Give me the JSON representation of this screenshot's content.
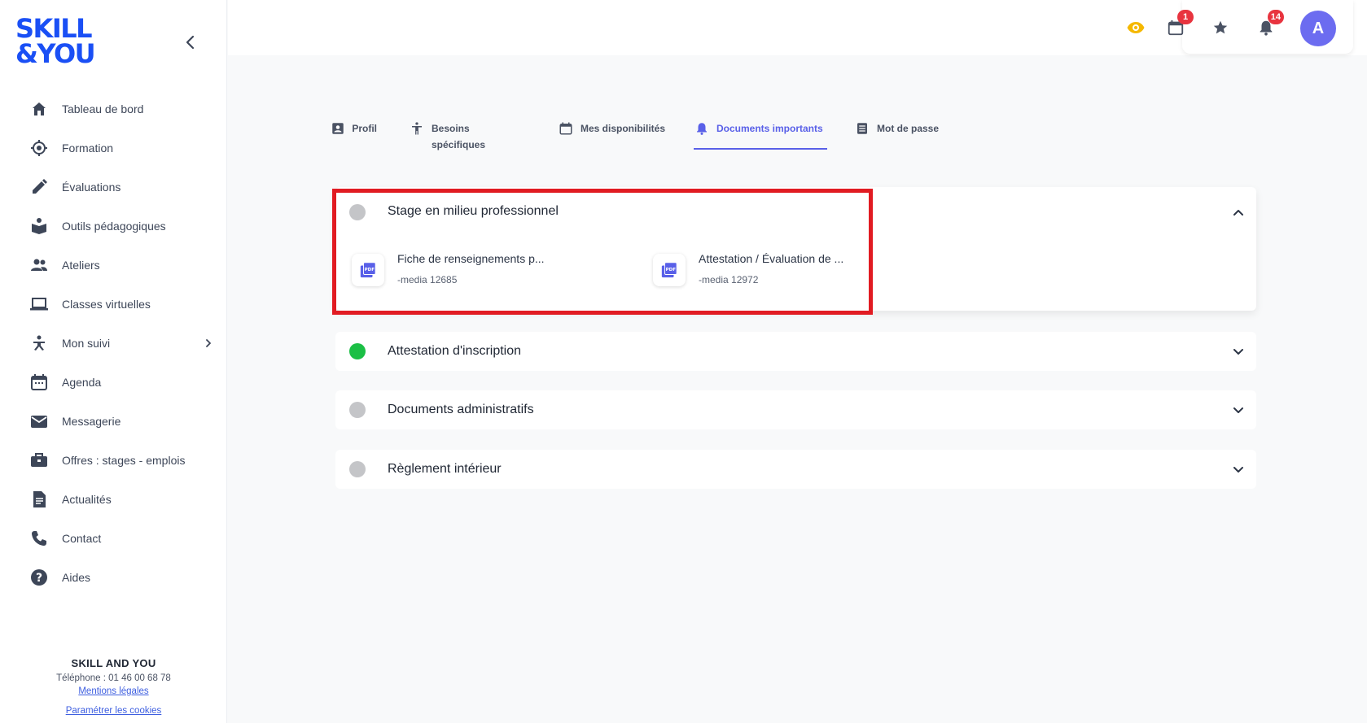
{
  "brand": {
    "line1": "SKILL",
    "line2": "&YOU",
    "color": "#1a4ff5"
  },
  "sidebar": {
    "items": [
      {
        "label": "Tableau de bord",
        "icon": "home-icon"
      },
      {
        "label": "Formation",
        "icon": "target-icon"
      },
      {
        "label": "Évaluations",
        "icon": "pencil-icon"
      },
      {
        "label": "Outils pédagogiques",
        "icon": "book-icon"
      },
      {
        "label": "Ateliers",
        "icon": "group-icon"
      },
      {
        "label": "Classes virtuelles",
        "icon": "laptop-icon"
      },
      {
        "label": "Mon suivi",
        "icon": "person-icon"
      },
      {
        "label": "Agenda",
        "icon": "calendar-icon"
      },
      {
        "label": "Messagerie",
        "icon": "mail-icon"
      },
      {
        "label": "Offres : stages - emplois",
        "icon": "briefcase-icon"
      },
      {
        "label": "Actualités",
        "icon": "news-icon"
      },
      {
        "label": "Contact",
        "icon": "phone-icon"
      },
      {
        "label": "Aides",
        "icon": "help-icon"
      }
    ],
    "footer": {
      "company": "SKILL AND YOU",
      "phone": "Téléphone : 01 46 00 68 78",
      "legal_link": "Mentions légales",
      "cookies_link": "Paramétrer les cookies"
    }
  },
  "header": {
    "calendar_badge": "1",
    "notifications_badge": "14",
    "avatar_initial": "A",
    "accent_eye": "#f5b800",
    "avatar_color": "#6c6cf0"
  },
  "tabs": [
    {
      "label": "Profil",
      "icon": "profile-card-icon",
      "active": false
    },
    {
      "label": "Besoins spécifiques",
      "icon": "accessibility-icon",
      "active": false
    },
    {
      "label": "Mes disponibilités",
      "icon": "calendar-icon",
      "active": false
    },
    {
      "label": "Documents importants",
      "icon": "bell-icon",
      "active": true
    },
    {
      "label": "Mot de passe",
      "icon": "document-icon",
      "active": false
    }
  ],
  "sections": [
    {
      "title": "Stage en milieu professionnel",
      "status_color": "#c4c5c8",
      "expanded": true,
      "documents": [
        {
          "name": "Fiche de renseignements p...",
          "meta": "-media 12685",
          "icon": "pdf-icon"
        },
        {
          "name": "Attestation / Évaluation de ...",
          "meta": "-media 12972",
          "icon": "pdf-icon"
        }
      ]
    },
    {
      "title": "Attestation d'inscription",
      "status_color": "#1bbf45",
      "expanded": false
    },
    {
      "title": "Documents administratifs",
      "status_color": "#c4c5c8",
      "expanded": false
    },
    {
      "title": "Règlement intérieur",
      "status_color": "#c4c5c8",
      "expanded": false
    }
  ],
  "accent_color": "#5960e8",
  "highlight_color": "#e11b22"
}
